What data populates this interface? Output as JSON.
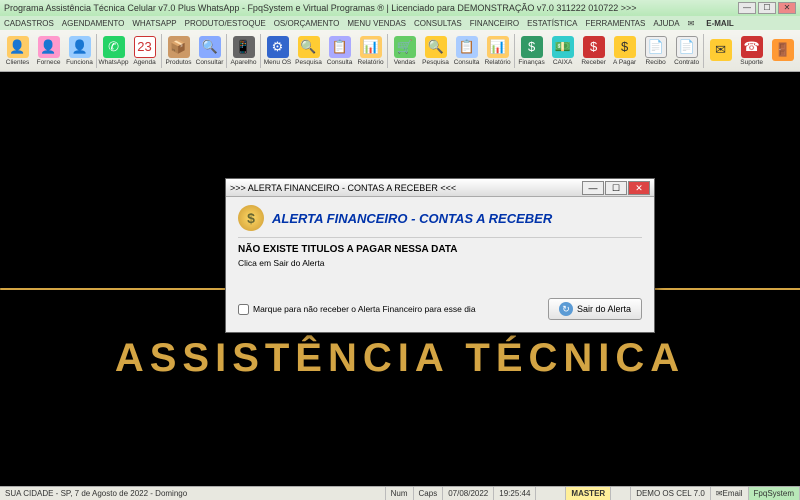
{
  "window": {
    "title": "Programa Assistência Técnica Celular v7.0 Plus WhatsApp - FpqSystem e Virtual Programas ® | Licenciado para  DEMONSTRAÇÃO v7.0 311222 010722 >>>"
  },
  "menu": {
    "items": [
      "CADASTROS",
      "AGENDAMENTO",
      "WHATSAPP",
      "PRODUTO/ESTOQUE",
      "OS/ORÇAMENTO",
      "MENU VENDAS",
      "CONSULTAS",
      "FINANCEIRO",
      "ESTATÍSTICA",
      "FERRAMENTAS",
      "AJUDA"
    ],
    "email": "E-MAIL"
  },
  "toolbar": {
    "buttons": [
      {
        "label": "Clientes",
        "icon": "ic-cliente",
        "glyph": "👤"
      },
      {
        "label": "Fornece",
        "icon": "ic-fornece",
        "glyph": "👤"
      },
      {
        "label": "Funciona",
        "icon": "ic-funcion",
        "glyph": "👤"
      },
      {
        "sep": true
      },
      {
        "label": "WhatsApp",
        "icon": "ic-whats",
        "glyph": "✆"
      },
      {
        "label": "Agenda",
        "icon": "ic-agenda",
        "glyph": "23"
      },
      {
        "sep": true
      },
      {
        "label": "Produtos",
        "icon": "ic-produto",
        "glyph": "📦"
      },
      {
        "label": "Consultar",
        "icon": "ic-consult",
        "glyph": "🔍"
      },
      {
        "sep": true
      },
      {
        "label": "Aparelho",
        "icon": "ic-aparelho",
        "glyph": "📱"
      },
      {
        "sep": true
      },
      {
        "label": "Menu OS",
        "icon": "ic-menuos",
        "glyph": "⚙"
      },
      {
        "label": "Pesquisa",
        "icon": "ic-pesq",
        "glyph": "🔍"
      },
      {
        "label": "Consulta",
        "icon": "ic-consulta2",
        "glyph": "📋"
      },
      {
        "label": "Relatório",
        "icon": "ic-relat",
        "glyph": "📊"
      },
      {
        "sep": true
      },
      {
        "label": "Vendas",
        "icon": "ic-vendas",
        "glyph": "🛒"
      },
      {
        "label": "Pesquisa",
        "icon": "ic-pesq2",
        "glyph": "🔍"
      },
      {
        "label": "Consulta",
        "icon": "ic-cons3",
        "glyph": "📋"
      },
      {
        "label": "Relatório",
        "icon": "ic-rel2",
        "glyph": "📊"
      },
      {
        "sep": true
      },
      {
        "label": "Finanças",
        "icon": "ic-finan",
        "glyph": "$"
      },
      {
        "label": "CAIXA",
        "icon": "ic-caixa",
        "glyph": "💵"
      },
      {
        "label": "Receber",
        "icon": "ic-receber",
        "glyph": "$"
      },
      {
        "label": "A Pagar",
        "icon": "ic-pagar",
        "glyph": "$"
      },
      {
        "label": "Recibo",
        "icon": "ic-recibo",
        "glyph": "📄"
      },
      {
        "label": "Contrato",
        "icon": "ic-contrato",
        "glyph": "📄"
      },
      {
        "sep": true
      },
      {
        "label": "",
        "icon": "ic-email2",
        "glyph": "✉"
      },
      {
        "label": "Suporte",
        "icon": "ic-suporte",
        "glyph": "☎"
      },
      {
        "label": "",
        "icon": "ic-sair",
        "glyph": "🚪"
      }
    ]
  },
  "logo": {
    "text": "ASSISTÊNCIA TÉCNICA"
  },
  "dialog": {
    "title": ">>> ALERTA FINANCEIRO - CONTAS A RECEBER <<<",
    "heading": "ALERTA FINANCEIRO - CONTAS A RECEBER",
    "message": "NÃO EXISTE TITULOS A PAGAR NESSA DATA",
    "sub": "Clica em Sair do Alerta",
    "checkbox": "Marque para não receber o Alerta Financeiro para esse dia",
    "exit_btn": "Sair do Alerta"
  },
  "statusbar": {
    "location": "SUA CIDADE - SP, 7 de Agosto de 2022 - Domingo",
    "num": "Num",
    "caps": "Caps",
    "date": "07/08/2022",
    "time": "19:25:44",
    "master": "MASTER",
    "demo": "DEMO OS CEL 7.0",
    "email": "Email",
    "brand": "FpqSystem"
  }
}
